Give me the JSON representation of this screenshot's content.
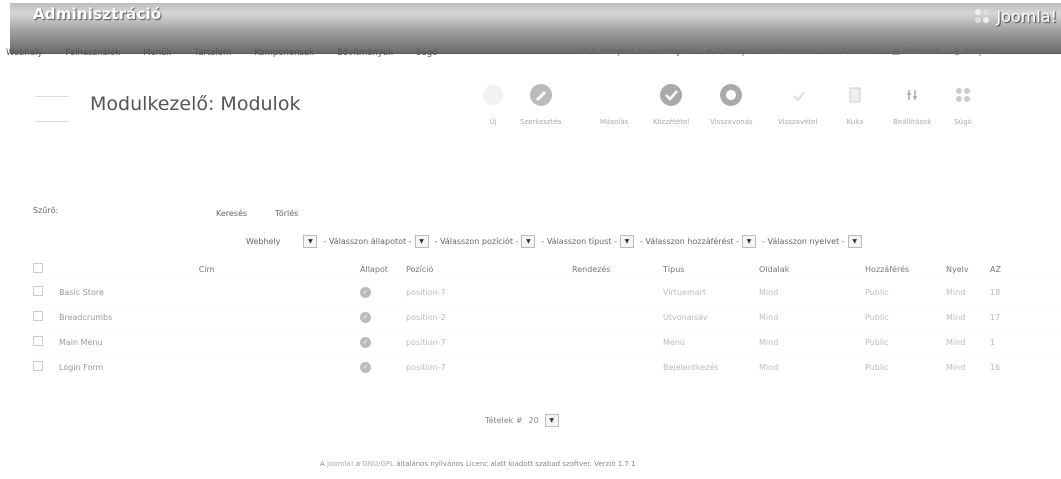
{
  "header": {
    "title": "Adminisztráció",
    "logo_text": "Joomla!"
  },
  "menu": {
    "items": [
      "Webhely",
      "Felhasználók",
      "Menük",
      "Tartalom",
      "Komponensek",
      "Bővítmények",
      "Súgó"
    ],
    "status": {
      "frontend_users": "0 belépett a webhelyen",
      "admin_users": "2 belépett az adminban",
      "messages": "1 üzenet",
      "preview": "Előnézet",
      "logout": "Kilépés"
    }
  },
  "page": {
    "title": "Modulkezelő: Modulok"
  },
  "toolbar": {
    "buttons": [
      {
        "label": "Új",
        "icon": "new-icon"
      },
      {
        "label": "Szerkesztés",
        "icon": "edit-icon"
      },
      {
        "label": "Másolás",
        "icon": "copy-icon"
      },
      {
        "label": "Közzététel",
        "icon": "publish-icon"
      },
      {
        "label": "Visszavonás",
        "icon": "unpublish-icon"
      },
      {
        "label": "Visszavétel",
        "icon": "checkin-icon"
      },
      {
        "label": "Kuka",
        "icon": "trash-icon"
      },
      {
        "label": "Beállítások",
        "icon": "options-icon"
      },
      {
        "label": "Súgó",
        "icon": "help-icon"
      }
    ]
  },
  "filters": {
    "label": "Szűrő:",
    "search_button": "Keresés",
    "reset_button": "Törlés",
    "site_select": "Webhely",
    "state_select": "- Válasszon állapotot -",
    "position_select": "- Válasszon pozíciót -",
    "type_select": "- Válasszon típust -",
    "access_select": "- Válasszon hozzáférést -",
    "language_select": "- Válasszon nyelvet -"
  },
  "table": {
    "headers": {
      "title": "Cím",
      "status": "Állapot",
      "position": "Pozíció",
      "ordering": "Rendezés",
      "type": "Típus",
      "pages": "Oldalak",
      "access": "Hozzáférés",
      "language": "Nyelv",
      "id": "AZ"
    },
    "rows": [
      {
        "title": "Basic Store",
        "position": "position-7",
        "type": "Virtuemart",
        "pages": "Mind",
        "access": "Public",
        "language": "Mind",
        "id": "18"
      },
      {
        "title": "Breadcrumbs",
        "position": "position-2",
        "type": "Útvonalsáv",
        "pages": "Mind",
        "access": "Public",
        "language": "Mind",
        "id": "17"
      },
      {
        "title": "Main Menu",
        "position": "position-7",
        "type": "Menü",
        "pages": "Mind",
        "access": "Public",
        "language": "Mind",
        "id": "1"
      },
      {
        "title": "Login Form",
        "position": "position-7",
        "type": "Bejelentkezés",
        "pages": "Mind",
        "access": "Public",
        "language": "Mind",
        "id": "16"
      }
    ]
  },
  "pagination": {
    "label": "Tételek #",
    "value": "20"
  },
  "footer": {
    "pre": "A",
    "joomla_link": "Joomla!",
    "mid": "a",
    "license_link": "GNU/GPL",
    "text": "általános nyilvános Licenc alatt kiadott szabad szoftver.",
    "version": "Verzió 1.7.1"
  }
}
